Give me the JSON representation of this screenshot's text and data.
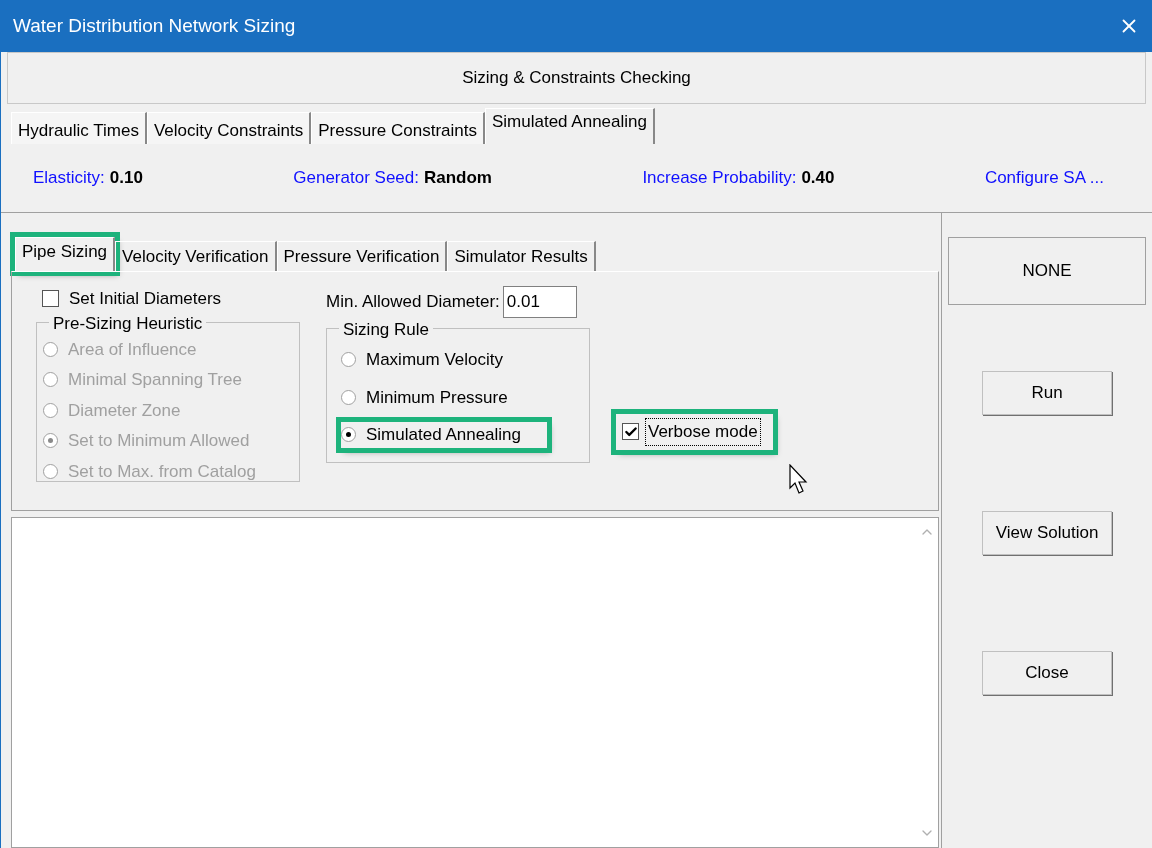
{
  "window": {
    "title": "Water Distribution Network Sizing"
  },
  "header": "Sizing & Constraints Checking",
  "top_tabs": [
    {
      "label": "Hydraulic Times",
      "selected": false
    },
    {
      "label": "Velocity Constraints",
      "selected": false
    },
    {
      "label": "Pressure Constraints",
      "selected": false
    },
    {
      "label": "Simulated Annealing",
      "selected": true
    }
  ],
  "parameters": [
    {
      "label": "Elasticity:",
      "value": "0.10"
    },
    {
      "label": "Generator Seed:",
      "value": "Random"
    },
    {
      "label": "Increase Probability:",
      "value": "0.40"
    }
  ],
  "configure_link": "Configure SA ...",
  "inner_tabs": [
    {
      "label": "Pipe Sizing",
      "selected": true,
      "highlighted": true
    },
    {
      "label": "Velocity Verification",
      "selected": false,
      "highlighted": false
    },
    {
      "label": "Pressure Verification",
      "selected": false,
      "highlighted": false
    },
    {
      "label": "Simulator Results",
      "selected": false,
      "highlighted": false
    }
  ],
  "set_initial_diameters": {
    "label": "Set Initial Diameters",
    "checked": false
  },
  "min_allowed_diameter": {
    "label": "Min. Allowed Diameter:",
    "value": "0.01"
  },
  "pre_sizing_heuristic": {
    "title": "Pre-Sizing Heuristic",
    "disabled": true,
    "options": [
      {
        "label": "Area of Influence",
        "selected": false
      },
      {
        "label": "Minimal Spanning Tree",
        "selected": false
      },
      {
        "label": "Diameter Zone",
        "selected": false
      },
      {
        "label": "Set to Minimum Allowed",
        "selected": true
      },
      {
        "label": "Set to Max. from Catalog",
        "selected": false
      }
    ]
  },
  "sizing_rule": {
    "title": "Sizing Rule",
    "options": [
      {
        "label": "Maximum Velocity",
        "selected": false,
        "highlighted": false
      },
      {
        "label": "Minimum Pressure",
        "selected": false,
        "highlighted": false
      },
      {
        "label": "Simulated Annealing",
        "selected": true,
        "highlighted": true
      }
    ]
  },
  "verbose_mode": {
    "label": "Verbose mode",
    "checked": true,
    "highlighted": true
  },
  "status": "NONE",
  "buttons": [
    "Run",
    "View Solution",
    "Close"
  ]
}
